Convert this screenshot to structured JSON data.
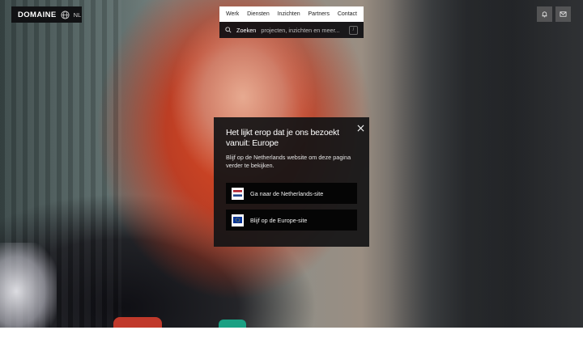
{
  "brand": {
    "logo": "DOMAINE",
    "language": "NL"
  },
  "nav": {
    "items": [
      {
        "label": "Werk"
      },
      {
        "label": "Diensten"
      },
      {
        "label": "Inzichten"
      },
      {
        "label": "Partners"
      },
      {
        "label": "Contact"
      }
    ]
  },
  "search": {
    "label": "Zoeken",
    "placeholder": "projecten, inzichten en meer...",
    "shortcut": "/"
  },
  "header_actions": {
    "bell_icon": "bell-icon",
    "mail_icon": "mail-icon"
  },
  "region_modal": {
    "title": "Het lijkt erop dat je ons bezoekt vanuit: Europe",
    "body": "Blijf op de Netherlands website om deze pagina verder te bekijken.",
    "options": [
      {
        "label": "Ga naar de Netherlands-site",
        "flag": "netherlands-flag"
      },
      {
        "label": "Blijf op de Europe-site",
        "flag": "europe-flag"
      }
    ]
  },
  "colors": {
    "modal_bg": "#141416",
    "button_bg": "#050505",
    "accent_red": "#e2461e"
  }
}
